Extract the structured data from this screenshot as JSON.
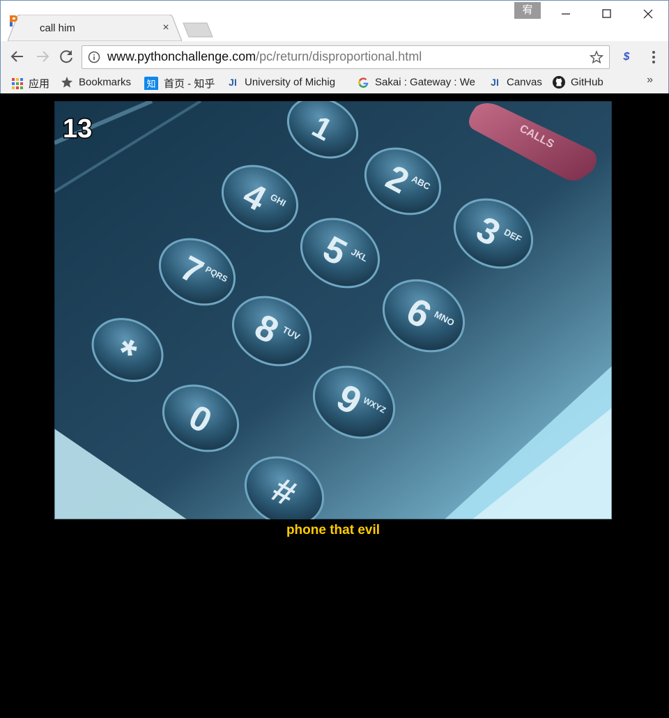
{
  "tab": {
    "title": "call him",
    "close": "×"
  },
  "ime": "宥",
  "address": {
    "host": "www.pythonchallenge.com",
    "path": "/pc/return/disproportional.html"
  },
  "bookmarks": [
    {
      "label": "应用",
      "icon": "apps-grid-icon"
    },
    {
      "label": "Bookmarks",
      "icon": "star-icon"
    },
    {
      "label": "首页 - 知乎",
      "icon": "zhihu-icon"
    },
    {
      "label": "University of Michig",
      "icon": "ji-icon"
    },
    {
      "label": "Sakai : Gateway : We",
      "icon": "google-icon"
    },
    {
      "label": "Canvas",
      "icon": "ji-icon"
    },
    {
      "label": "GitHub",
      "icon": "github-icon"
    }
  ],
  "bookmarks_more": "»",
  "page": {
    "badge": "13",
    "keys": [
      "1",
      "2",
      "3",
      "4",
      "5",
      "6",
      "7",
      "8",
      "9",
      "*",
      "0",
      "#"
    ],
    "key_letters": [
      "ABC",
      "DEF",
      "GHI",
      "JKL",
      "MNO",
      "PQRS",
      "TUV",
      "WXYZ"
    ],
    "calls_label": "CALLS",
    "caption": "phone that evil"
  },
  "colors": {
    "caption": "#ffcc00",
    "background": "#000000",
    "phone_body": "#1f3e55",
    "key_face": "#2d5872"
  }
}
